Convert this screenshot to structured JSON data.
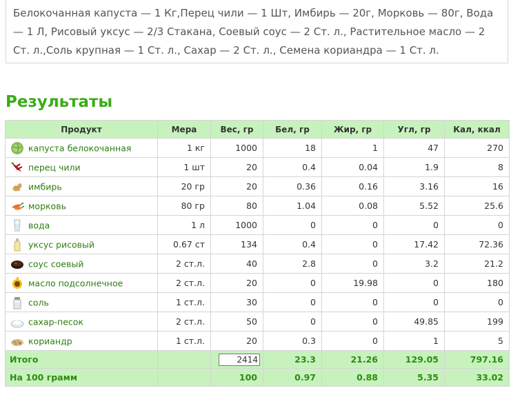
{
  "ingredients_text": "Белокочанная капуста — 1 Кг,Перец чили — 1 Шт, Имбирь — 20г, Морковь — 80г, Вода — 1 Л, Рисовый уксус — 2/3 Стакана, Соевый соус — 2 Ст. л., Растительное масло — 2 Ст. л.,Соль крупная — 1 Ст. л., Сахар — 2 Ст. л., Семена кориандра — 1 Ст. л.",
  "results_title": "Результаты",
  "columns": [
    "Продукт",
    "Мера",
    "Вес, гр",
    "Бел, гр",
    "Жир, гр",
    "Угл, гр",
    "Кал, ккал"
  ],
  "rows": [
    {
      "icon": "cabbage-icon",
      "product": "капуста белокочанная",
      "measure": "1 кг",
      "weight": "1000",
      "protein": "18",
      "fat": "1",
      "carbs": "47",
      "kcal": "270"
    },
    {
      "icon": "chili-pepper-icon",
      "product": "перец чили",
      "measure": "1 шт",
      "weight": "20",
      "protein": "0.4",
      "fat": "0.04",
      "carbs": "1.9",
      "kcal": "8"
    },
    {
      "icon": "ginger-icon",
      "product": "имбирь",
      "measure": "20 гр",
      "weight": "20",
      "protein": "0.36",
      "fat": "0.16",
      "carbs": "3.16",
      "kcal": "16"
    },
    {
      "icon": "carrot-icon",
      "product": "морковь",
      "measure": "80 гр",
      "weight": "80",
      "protein": "1.04",
      "fat": "0.08",
      "carbs": "5.52",
      "kcal": "25.6"
    },
    {
      "icon": "water-glass-icon",
      "product": "вода",
      "measure": "1 л",
      "weight": "1000",
      "protein": "0",
      "fat": "0",
      "carbs": "0",
      "kcal": "0"
    },
    {
      "icon": "vinegar-bottle-icon",
      "product": "уксус рисовый",
      "measure": "0.67 ст",
      "weight": "134",
      "protein": "0.4",
      "fat": "0",
      "carbs": "17.42",
      "kcal": "72.36"
    },
    {
      "icon": "soy-sauce-icon",
      "product": "соус соевый",
      "measure": "2 ст.л.",
      "weight": "40",
      "protein": "2.8",
      "fat": "0",
      "carbs": "3.2",
      "kcal": "21.2"
    },
    {
      "icon": "sunflower-oil-icon",
      "product": "масло подсолнечное",
      "measure": "2 ст.л.",
      "weight": "20",
      "protein": "0",
      "fat": "19.98",
      "carbs": "0",
      "kcal": "180"
    },
    {
      "icon": "salt-shaker-icon",
      "product": "соль",
      "measure": "1 ст.л.",
      "weight": "30",
      "protein": "0",
      "fat": "0",
      "carbs": "0",
      "kcal": "0"
    },
    {
      "icon": "sugar-icon",
      "product": "сахар-песок",
      "measure": "2 ст.л.",
      "weight": "50",
      "protein": "0",
      "fat": "0",
      "carbs": "49.85",
      "kcal": "199"
    },
    {
      "icon": "coriander-seeds-icon",
      "product": "кориандр",
      "measure": "1 ст.л.",
      "weight": "20",
      "protein": "0.3",
      "fat": "0",
      "carbs": "1",
      "kcal": "5"
    }
  ],
  "total": {
    "label": "Итого",
    "weight": "2414",
    "protein": "23.3",
    "fat": "21.26",
    "carbs": "129.05",
    "kcal": "797.16"
  },
  "per100": {
    "label": "На 100 грамм",
    "weight": "100",
    "protein": "0.97",
    "fat": "0.88",
    "carbs": "5.35",
    "kcal": "33.02"
  },
  "colors": {
    "accent_green": "#3aac18",
    "header_bg": "#c7f2bd",
    "link_green": "#2e7d0f"
  }
}
